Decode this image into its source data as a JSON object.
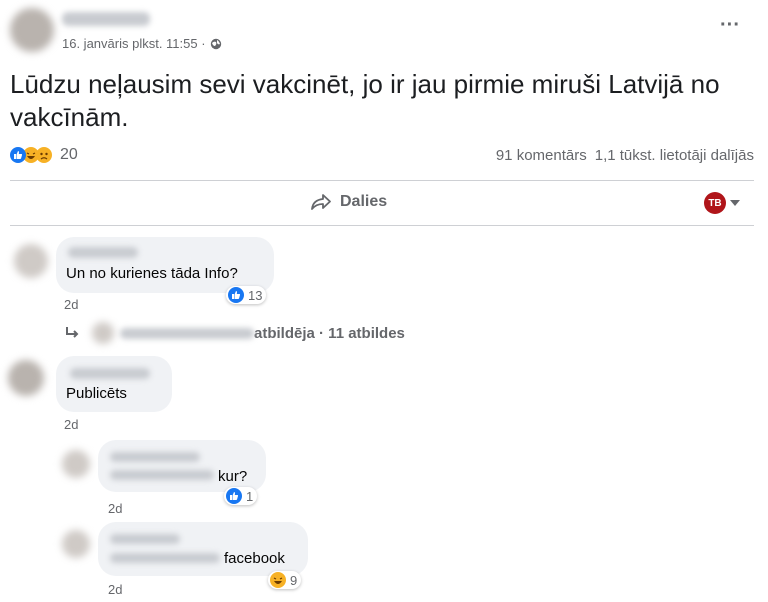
{
  "post": {
    "timestamp": "16. janvāris plkst. 11:55 ·",
    "text": "Lūdzu neļausim sevi vakcinēt, jo ir jau pirmie miruši Latvijā no vakcīnām.",
    "reaction_count": "20",
    "comments_count": "91 komentārs",
    "shares_count": "1,1 tūkst. lietotāji dalījās",
    "share_label": "Dalies",
    "more_label": "···",
    "page_badge": "TB"
  },
  "comments": [
    {
      "text": "Un no kurienes tāda Info?",
      "age": "2d",
      "reaction_count": "13",
      "replies_link": "atbildēja · 11 atbildes"
    },
    {
      "text": "Publicēts",
      "age": "2d"
    }
  ],
  "replies": [
    {
      "text": "kur?",
      "age": "2d",
      "reaction_count": "1"
    },
    {
      "text": "facebook",
      "age": "2d",
      "reaction_count": "9"
    }
  ],
  "colors": {
    "like": "#1877f2",
    "haha": "#f7b125",
    "meta": "#65676b",
    "bubble": "#f0f2f5"
  }
}
